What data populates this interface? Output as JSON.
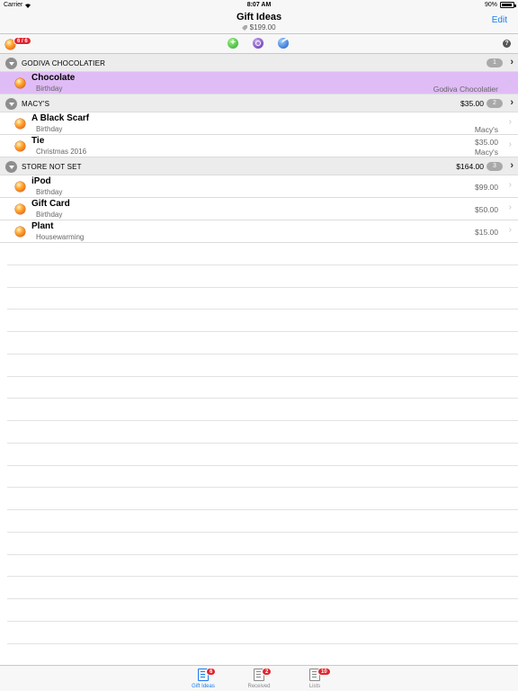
{
  "status_bar": {
    "carrier": "Carrier",
    "time": "8:07 AM",
    "battery": "90%",
    "wifi_icon": "wifi-icon"
  },
  "nav": {
    "title": "Gift Ideas",
    "subtitle": "$199.00",
    "edit_label": "Edit"
  },
  "toolbar": {
    "counter_badge": "6 / 6",
    "add_icon": "plus-circle-icon",
    "target_icon": "target-icon",
    "ball_icon": "swoosh-ball-icon",
    "help_label": "?"
  },
  "sections": [
    {
      "name": "GODIVA CHOCOLATIER",
      "total": "",
      "count": "1",
      "items": [
        {
          "title": "Chocolate",
          "occasion": "Birthday",
          "price": "",
          "store": "Godiva Chocolatier",
          "selected": true
        }
      ]
    },
    {
      "name": "MACY'S",
      "total": "$35.00",
      "count": "2",
      "items": [
        {
          "title": "A Black Scarf",
          "occasion": "Birthday",
          "price": "",
          "store": "Macy's",
          "selected": false
        },
        {
          "title": "Tie",
          "occasion": "Christmas 2016",
          "price": "$35.00",
          "store": "Macy's",
          "selected": false
        }
      ]
    },
    {
      "name": "STORE NOT SET",
      "total": "$164.00",
      "count": "3",
      "items": [
        {
          "title": "iPod",
          "occasion": "Birthday",
          "price": "$99.00",
          "store": "",
          "selected": false
        },
        {
          "title": "Gift Card",
          "occasion": "Birthday",
          "price": "$50.00",
          "store": "",
          "selected": false
        },
        {
          "title": "Plant",
          "occasion": "Housewarming",
          "price": "$15.00",
          "store": "",
          "selected": false
        }
      ]
    }
  ],
  "tabs": [
    {
      "label": "Gift Ideas",
      "badge": "6",
      "active": true,
      "icon": "gift-list-icon"
    },
    {
      "label": "Received",
      "badge": "2",
      "active": false,
      "icon": "received-icon"
    },
    {
      "label": "Lists",
      "badge": "10",
      "active": false,
      "icon": "lists-icon"
    }
  ],
  "colors": {
    "accent": "#1a7cf0",
    "selected_row": "#e0bcf6",
    "badge_red": "#e0262e"
  }
}
